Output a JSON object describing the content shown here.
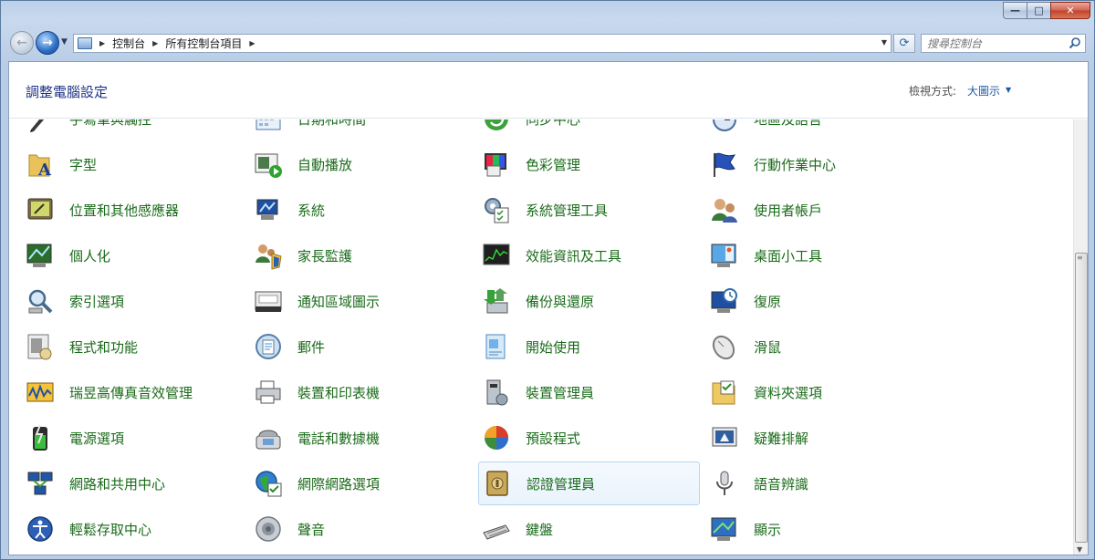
{
  "window": {
    "caption_minimize": "—",
    "caption_maximize": "□",
    "caption_close": "✕"
  },
  "nav": {
    "breadcrumb": [
      "控制台",
      "所有控制台項目"
    ],
    "search_placeholder": "搜尋控制台"
  },
  "header": {
    "title": "調整電腦設定",
    "view_by_label": "檢視方式:",
    "view_by_value": "大圖示"
  },
  "colors": {
    "item_text": "#1a6b1a",
    "title_text": "#1e3287",
    "link_blue": "#1e5aa6"
  },
  "items": [
    {
      "label": "手寫筆與觸控",
      "icon": "pen-icon"
    },
    {
      "label": "日期和時間",
      "icon": "calendar-icon"
    },
    {
      "label": "同步中心",
      "icon": "sync-icon"
    },
    {
      "label": "地區及語言",
      "icon": "clock-globe-icon"
    },
    {
      "label": "字型",
      "icon": "font-folder-icon"
    },
    {
      "label": "自動播放",
      "icon": "autoplay-icon"
    },
    {
      "label": "色彩管理",
      "icon": "color-management-icon"
    },
    {
      "label": "行動作業中心",
      "icon": "action-center-flag-icon"
    },
    {
      "label": "位置和其他感應器",
      "icon": "location-sensor-icon"
    },
    {
      "label": "系統",
      "icon": "system-computer-icon"
    },
    {
      "label": "系統管理工具",
      "icon": "admin-tools-icon"
    },
    {
      "label": "使用者帳戶",
      "icon": "user-accounts-icon"
    },
    {
      "label": "個人化",
      "icon": "personalization-icon"
    },
    {
      "label": "家長監護",
      "icon": "parental-controls-icon"
    },
    {
      "label": "效能資訊及工具",
      "icon": "performance-icon"
    },
    {
      "label": "桌面小工具",
      "icon": "desktop-gadgets-icon"
    },
    {
      "label": "索引選項",
      "icon": "indexing-icon"
    },
    {
      "label": "通知區域圖示",
      "icon": "notification-area-icon"
    },
    {
      "label": "備份與還原",
      "icon": "backup-restore-icon"
    },
    {
      "label": "復原",
      "icon": "recovery-icon"
    },
    {
      "label": "程式和功能",
      "icon": "programs-features-icon"
    },
    {
      "label": "郵件",
      "icon": "mail-icon"
    },
    {
      "label": "開始使用",
      "icon": "getting-started-icon"
    },
    {
      "label": "滑鼠",
      "icon": "mouse-icon"
    },
    {
      "label": "瑞昱高傳真音效管理",
      "icon": "realtek-audio-icon"
    },
    {
      "label": "裝置和印表機",
      "icon": "devices-printers-icon"
    },
    {
      "label": "裝置管理員",
      "icon": "device-manager-icon"
    },
    {
      "label": "資料夾選項",
      "icon": "folder-options-icon"
    },
    {
      "label": "電源選項",
      "icon": "power-options-icon"
    },
    {
      "label": "電話和數據機",
      "icon": "phone-modem-icon"
    },
    {
      "label": "預設程式",
      "icon": "default-programs-icon"
    },
    {
      "label": "疑難排解",
      "icon": "troubleshooting-icon"
    },
    {
      "label": "網路和共用中心",
      "icon": "network-sharing-icon"
    },
    {
      "label": "網際網路選項",
      "icon": "internet-options-icon"
    },
    {
      "label": "認證管理員",
      "icon": "credential-manager-icon"
    },
    {
      "label": "語音辨識",
      "icon": "speech-recognition-icon"
    },
    {
      "label": "輕鬆存取中心",
      "icon": "ease-of-access-icon"
    },
    {
      "label": "聲音",
      "icon": "sound-icon"
    },
    {
      "label": "鍵盤",
      "icon": "keyboard-icon"
    },
    {
      "label": "顯示",
      "icon": "display-icon"
    }
  ],
  "selected_item": "認證管理員"
}
